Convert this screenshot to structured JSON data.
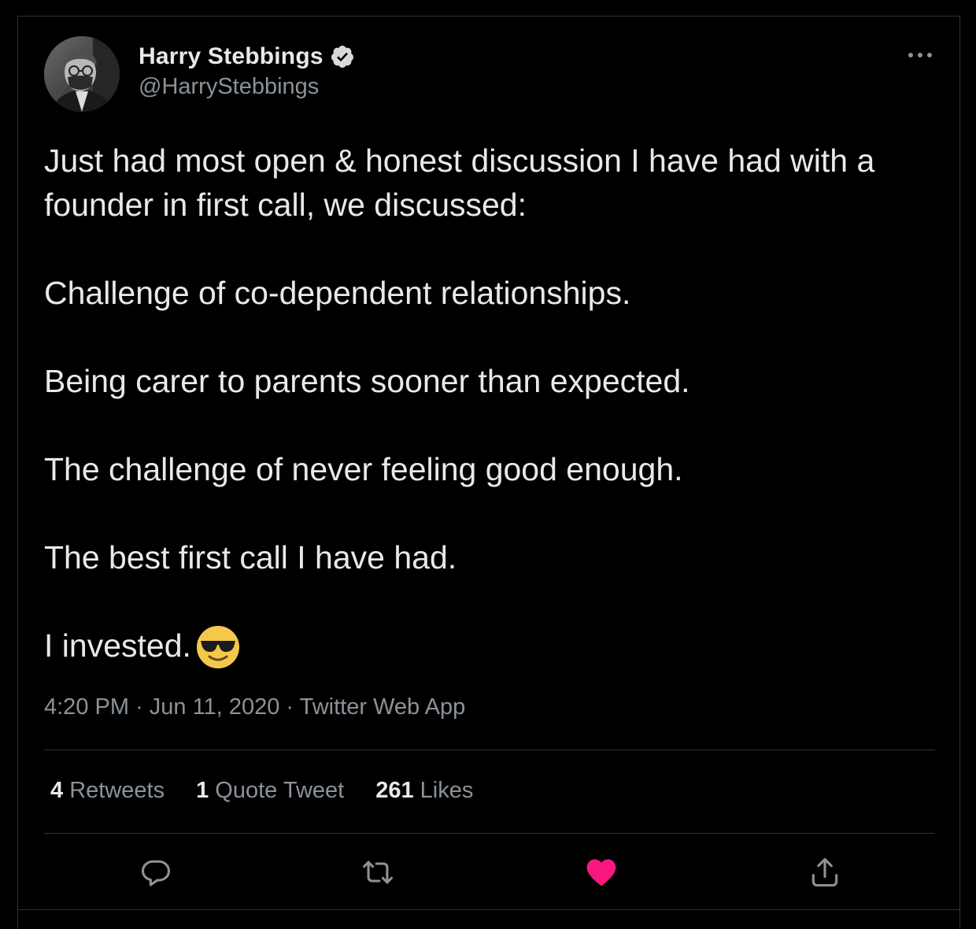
{
  "author": {
    "display_name": "Harry Stebbings",
    "handle": "@HarryStebbings",
    "verified": true
  },
  "tweet": {
    "paragraphs": [
      "Just had most open & honest discussion I have had with a founder in first call, we discussed:",
      "Challenge of co-dependent relationships.",
      "Being carer to parents sooner than expected.",
      "The challenge of never feeling good enough.",
      "The best first call I have had.",
      "I invested."
    ],
    "emoji": "smiling-face-with-sunglasses"
  },
  "meta": {
    "time": "4:20 PM",
    "date": "Jun 11, 2020",
    "source": "Twitter Web App",
    "separator": "·"
  },
  "stats": {
    "retweets_count": "4",
    "retweets_label": "Retweets",
    "quotes_count": "1",
    "quotes_label": "Quote Tweet",
    "likes_count": "261",
    "likes_label": "Likes"
  },
  "actions": {
    "icons": [
      "reply-icon",
      "retweet-icon",
      "like-icon",
      "share-icon"
    ],
    "liked": true
  },
  "colors": {
    "background": "#000000",
    "text": "#e7e9ea",
    "secondary_text": "#8b9298",
    "divider": "#2f3336",
    "like": "#f91880"
  }
}
